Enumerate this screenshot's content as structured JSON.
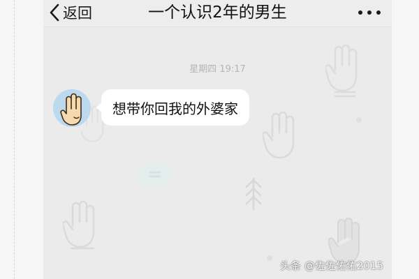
{
  "nav": {
    "back_label": "返回",
    "title": "一个认识2年的男生",
    "more_icon": "more-dots-icon"
  },
  "chat": {
    "timestamp": "星期四 19:17",
    "messages": [
      {
        "sender": "contact",
        "avatar_icon": "raised-hand-avatar",
        "text": "想带你回我的外婆家"
      }
    ]
  },
  "watermark": {
    "text": "头条 @佐佐佑佑2015"
  },
  "colors": {
    "chat_background": "#ebebeb",
    "bubble": "#ffffff",
    "avatar_background": "#bcd9ee",
    "timestamp_text": "#b4b4b4"
  }
}
